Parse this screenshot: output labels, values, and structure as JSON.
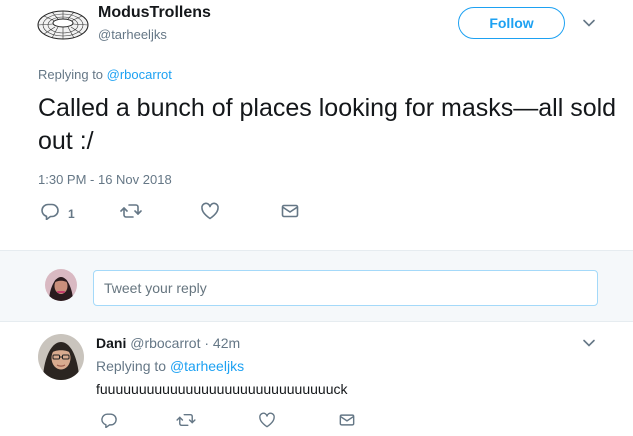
{
  "tweet": {
    "display_name": "ModusTrollens",
    "handle": "@tarheeljks",
    "follow_label": "Follow",
    "replying_prefix": "Replying to ",
    "replying_to": "@rbocarrot",
    "text": "Called a bunch of places looking for masks—all sold out :/",
    "timestamp": "1:30 PM - 16 Nov 2018",
    "reply_count": "1"
  },
  "compose": {
    "placeholder": "Tweet your reply"
  },
  "reply": {
    "display_name": "Dani",
    "handle": "@rbocarrot",
    "separator": "·",
    "time": "42m",
    "replying_prefix": "Replying to ",
    "replying_to": "@tarheeljks",
    "text": "fuuuuuuuuuuuuuuuuuuuuuuuuuuuuuuck"
  },
  "colors": {
    "accent": "#1da1f2",
    "muted": "#657786",
    "text": "#14171a",
    "compose_bg": "#f5f8fa"
  },
  "icons": [
    "reply-icon",
    "retweet-icon",
    "like-icon",
    "direct-message-icon",
    "chevron-down-icon"
  ]
}
